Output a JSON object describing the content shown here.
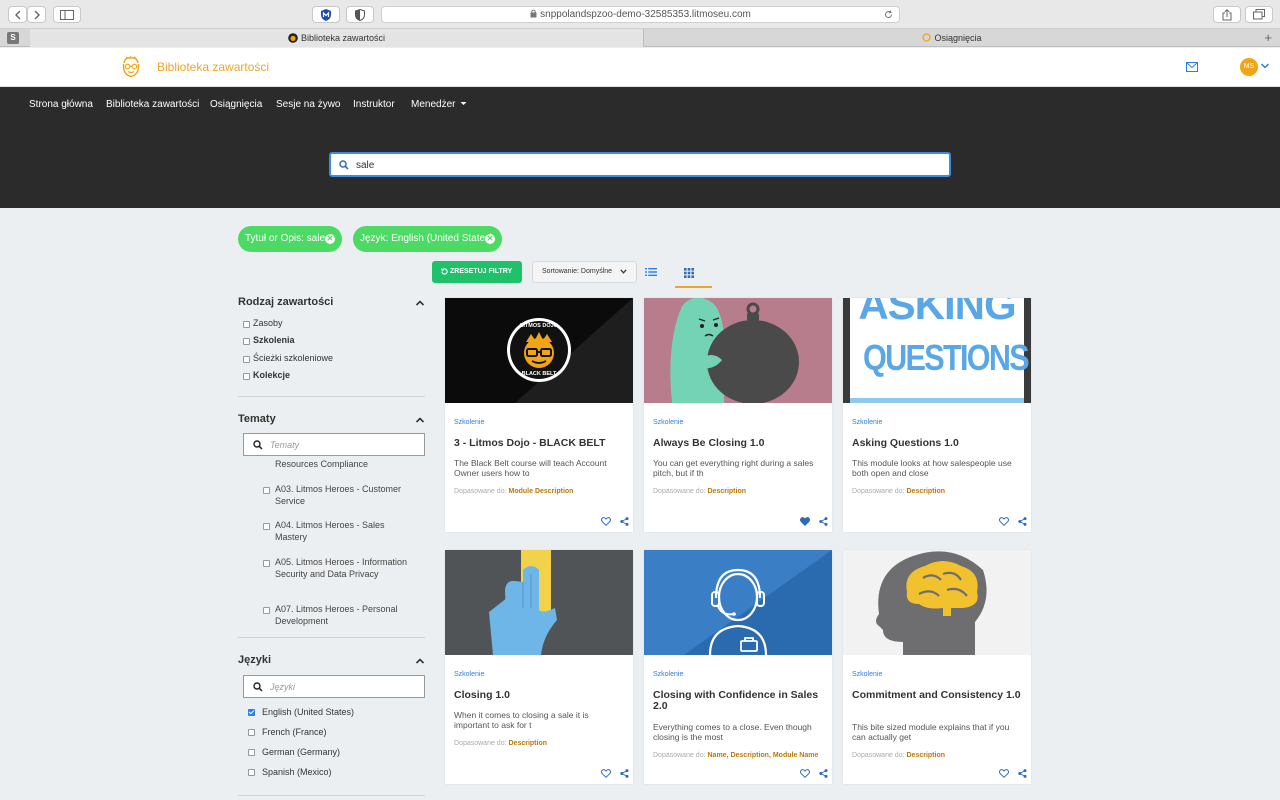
{
  "browser": {
    "url": "snppolandspzoo-demo-32585353.litmoseu.com",
    "tabs": [
      "Biblioteka zawartości",
      "Osiągnięcia"
    ],
    "tab_plus": "+",
    "sidebar_badge": "S"
  },
  "header": {
    "title": "Biblioteka zawartości",
    "avatar_initials": "MS"
  },
  "nav": {
    "items": [
      "Strona główna",
      "Biblioteka zawartości",
      "Osiągnięcia",
      "Sesje na żywo",
      "Instruktor",
      "Menedżer"
    ],
    "search_value": "sale"
  },
  "filters": {
    "chips": [
      "Tytuł or Opis: sale",
      "Język: English (United States)"
    ],
    "reset_label": "ZRESETUJ FILTRY",
    "sort_label": "Sortowanie: Domyślne"
  },
  "sidebar": {
    "content_type": {
      "title": "Rodzaj zawartości",
      "items": [
        "Zasoby",
        "Szkolenia",
        "Ścieżki szkoleniowe",
        "Kolekcje"
      ]
    },
    "topics": {
      "title": "Tematy",
      "search_placeholder": "Tematy",
      "partial_item": "Resources Compliance",
      "items": [
        "A03. Litmos Heroes - Customer Service",
        "A04. Litmos Heroes - Sales Mastery",
        "A05. Litmos Heroes - Information Security and Data Privacy",
        "A07. Litmos Heroes - Personal Development"
      ]
    },
    "languages": {
      "title": "Języki",
      "search_placeholder": "Języki",
      "items": [
        "English (United States)",
        "French (France)",
        "German (Germany)",
        "Spanish (Mexico)"
      ],
      "checked_index": 0
    }
  },
  "cards": [
    {
      "type": "Szkolenie",
      "title": "3 - Litmos Dojo - BLACK BELT",
      "description": "The Black Belt course will teach Account Owner users how to",
      "match_prefix": "Dopasowane do:",
      "match_fields": "Module Description",
      "liked": false,
      "image": "litmos-dojo-black-belt",
      "logo_top": "LITMOS DOJO",
      "logo_bottom": "BLACK BELT"
    },
    {
      "type": "Szkolenie",
      "title": "Always Be Closing 1.0",
      "description": "You can get everything right during a sales pitch, but if th",
      "match_prefix": "Dopasowane do:",
      "match_fields": "Description",
      "liked": true,
      "image": "character-with-weight"
    },
    {
      "type": "Szkolenie",
      "title": "Asking Questions 1.0",
      "description": "This module looks at how salespeople use both open and close",
      "match_prefix": "Dopasowane do:",
      "match_fields": "Description",
      "liked": false,
      "image": "asking-questions-sign",
      "sign_line1": "ASKING",
      "sign_line2": "QUESTIONS"
    },
    {
      "type": "Szkolenie",
      "title": "Closing 1.0",
      "description": "When it comes to closing a sale it is important to ask for t",
      "match_prefix": "Dopasowane do:",
      "match_fields": "Description",
      "liked": false,
      "image": "hand-with-card"
    },
    {
      "type": "Szkolenie",
      "title": "Closing with Confidence in Sales 2.0",
      "description": "Everything comes to a close. Even though closing is the most",
      "match_prefix": "Dopasowane do:",
      "match_fields": "Name, Description, Module Name",
      "liked": false,
      "image": "headset-agent"
    },
    {
      "type": "Szkolenie",
      "title": "Commitment and Consistency 1.0",
      "description": "This bite sized module explains that if you can actually get",
      "match_prefix": "Dopasowane do:",
      "match_fields": "Description",
      "liked": false,
      "image": "head-with-brain"
    }
  ],
  "colors": {
    "accent": "#f0a52a",
    "chip_green": "#4cd964",
    "reset_green": "#1fc16b",
    "link_blue": "#2e7de6",
    "nav_dark": "#2b2b2b"
  }
}
